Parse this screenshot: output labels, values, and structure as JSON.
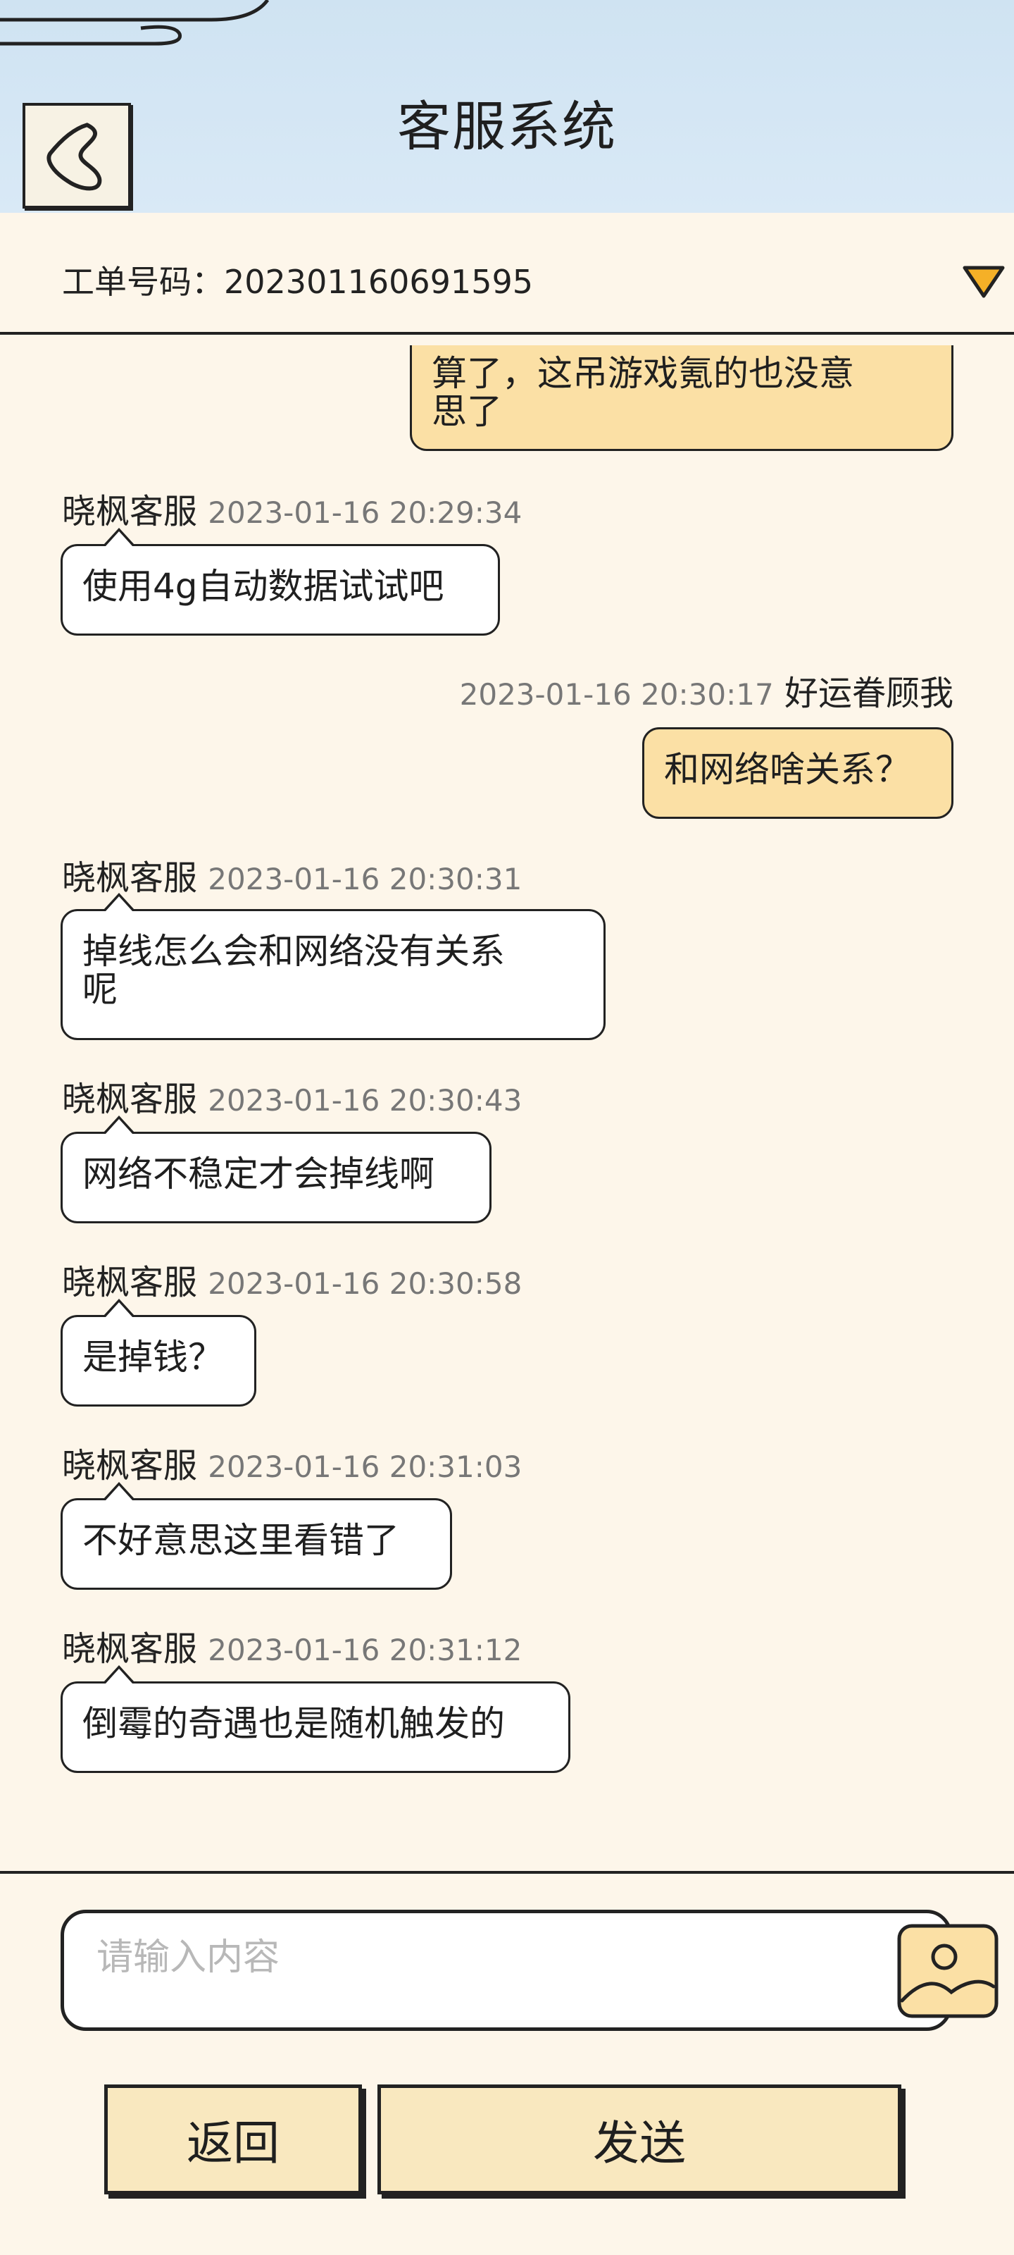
{
  "header": {
    "title": "客服系统",
    "back_icon": "chevron-left-icon"
  },
  "ticket": {
    "label": "工单号码：202301160691595",
    "dropdown_icon": "triangle-down-icon",
    "dropdown_color": "#f5b027"
  },
  "messages": [
    {
      "side": "me",
      "name": "",
      "time": "",
      "text": "算了，这吊游戏氪的也没意\n思了"
    },
    {
      "side": "agent",
      "name": "晓枫客服",
      "time": "2023-01-16 20:29:34",
      "text": "使用4g自动数据试试吧"
    },
    {
      "side": "me",
      "name": "好运眷顾我",
      "time": "2023-01-16 20:30:17",
      "text": "和网络啥关系？"
    },
    {
      "side": "agent",
      "name": "晓枫客服",
      "time": "2023-01-16 20:30:31",
      "text": "掉线怎么会和网络没有关系\n呢"
    },
    {
      "side": "agent",
      "name": "晓枫客服",
      "time": "2023-01-16 20:30:43",
      "text": "网络不稳定才会掉线啊"
    },
    {
      "side": "agent",
      "name": "晓枫客服",
      "time": "2023-01-16 20:30:58",
      "text": "是掉钱？"
    },
    {
      "side": "agent",
      "name": "晓枫客服",
      "time": "2023-01-16 20:31:03",
      "text": "不好意思这里看错了"
    },
    {
      "side": "agent",
      "name": "晓枫客服",
      "time": "2023-01-16 20:31:12",
      "text": "倒霉的奇遇也是随机触发的"
    }
  ],
  "input": {
    "placeholder": "请输入内容",
    "image_icon": "image-icon"
  },
  "buttons": {
    "return_label": "返回",
    "send_label": "发送"
  },
  "colors": {
    "header_bg": "#d4e6f4",
    "page_bg": "#fdf6ea",
    "my_bubble": "#fbe0a5",
    "agent_bubble": "#ffffff",
    "button_bg": "#f9e8bf"
  }
}
